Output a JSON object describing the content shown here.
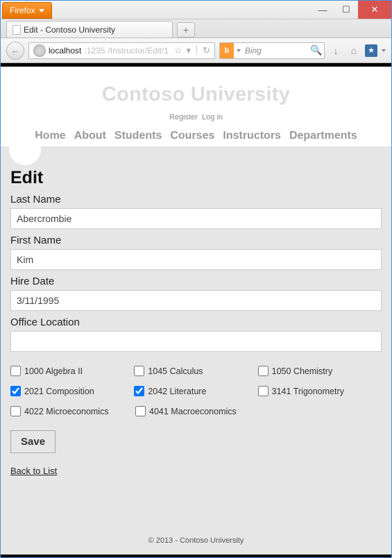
{
  "browser": {
    "name": "Firefox",
    "tab_title": "Edit - Contoso University",
    "url": {
      "host": "localhost",
      "port": ":1235",
      "path": "/Instructor/Edit/1"
    },
    "search_provider": "Bing",
    "newtab_glyph": "+",
    "back_glyph": "←",
    "star_glyph": "☆",
    "reload_glyph": "↻",
    "download_glyph": "↓",
    "home_glyph": "⌂",
    "search_glyph": "🔍",
    "bookmark_glyph": "★"
  },
  "site": {
    "title": "Contoso University",
    "auth": {
      "register": "Register",
      "login": "Log in"
    },
    "nav": {
      "home": "Home",
      "about": "About",
      "students": "Students",
      "courses": "Courses",
      "instructors": "Instructors",
      "departments": "Departments"
    }
  },
  "page": {
    "heading": "Edit",
    "fields": {
      "last_name": {
        "label": "Last Name",
        "value": "Abercrombie"
      },
      "first_name": {
        "label": "First Name",
        "value": "Kim"
      },
      "hire_date": {
        "label": "Hire Date",
        "value": "3/11/1995"
      },
      "office_location": {
        "label": "Office Location",
        "value": ""
      }
    },
    "courses": [
      [
        {
          "label": "1000 Algebra II",
          "checked": false
        },
        {
          "label": "1045 Calculus",
          "checked": false
        },
        {
          "label": "1050 Chemistry",
          "checked": false
        }
      ],
      [
        {
          "label": "2021 Composition",
          "checked": true
        },
        {
          "label": "2042 Literature",
          "checked": true
        },
        {
          "label": "3141 Trigonometry",
          "checked": false
        }
      ],
      [
        {
          "label": "4022 Microeconomics",
          "checked": false
        },
        {
          "label": "4041 Macroeconomics",
          "checked": false
        }
      ]
    ],
    "save_label": "Save",
    "back_label": "Back to List"
  },
  "footer": "© 2013 - Contoso University"
}
